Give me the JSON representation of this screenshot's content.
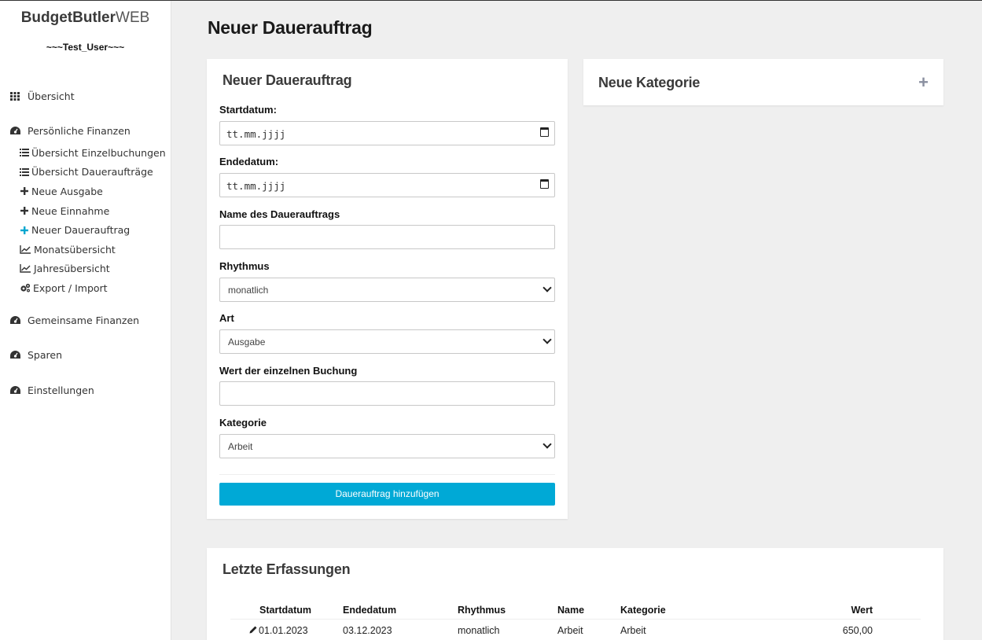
{
  "sidebar": {
    "brand_bold": "BudgetButler",
    "brand_light": "WEB",
    "user": "~~~Test_User~~~",
    "items": [
      {
        "label": "Übersicht",
        "icon": "grid-icon"
      },
      {
        "label": "Persönliche Finanzen",
        "icon": "dashboard-icon"
      },
      {
        "label": "Gemeinsame Finanzen",
        "icon": "dashboard-icon"
      },
      {
        "label": "Sparen",
        "icon": "dashboard-icon"
      },
      {
        "label": "Einstellungen",
        "icon": "dashboard-icon"
      }
    ],
    "sub_items": [
      {
        "label": "Übersicht Einzelbuchungen",
        "icon": "list-icon"
      },
      {
        "label": "Übersicht Daueraufträge",
        "icon": "list-icon"
      },
      {
        "label": "Neue Ausgabe",
        "icon": "plus-icon"
      },
      {
        "label": "Neue Einnahme",
        "icon": "plus-icon"
      },
      {
        "label": "Neuer Dauerauftrag",
        "icon": "plus-icon",
        "active": true
      },
      {
        "label": "Monatsübersicht",
        "icon": "line-chart-icon"
      },
      {
        "label": "Jahresübersicht",
        "icon": "line-chart-icon"
      },
      {
        "label": "Export / Import",
        "icon": "gears-icon"
      }
    ]
  },
  "page": {
    "title": "Neuer Dauerauftrag"
  },
  "form": {
    "title": "Neuer Dauerauftrag",
    "startdatum_label": "Startdatum:",
    "startdatum_placeholder": "tt.mm.jjjj",
    "endedatum_label": "Endedatum:",
    "endedatum_placeholder": "tt.mm.jjjj",
    "name_label": "Name des Dauerauftrags",
    "name_value": "",
    "rhythmus_label": "Rhythmus",
    "rhythmus_value": "monatlich",
    "art_label": "Art",
    "art_value": "Ausgabe",
    "wert_label": "Wert der einzelnen Buchung",
    "wert_value": "",
    "kategorie_label": "Kategorie",
    "kategorie_value": "Arbeit",
    "submit_label": "Dauerauftrag hinzufügen"
  },
  "category_card": {
    "title": "Neue Kategorie",
    "expand_symbol": "+"
  },
  "recent": {
    "title": "Letzte Erfassungen",
    "columns": [
      "Startdatum",
      "Endedatum",
      "Rhythmus",
      "Name",
      "Kategorie",
      "Wert"
    ],
    "rows": [
      {
        "startdatum": "01.01.2023",
        "endedatum": "03.12.2023",
        "rhythmus": "monatlich",
        "name": "Arbeit",
        "kategorie": "Arbeit",
        "wert": "650,00"
      }
    ]
  }
}
